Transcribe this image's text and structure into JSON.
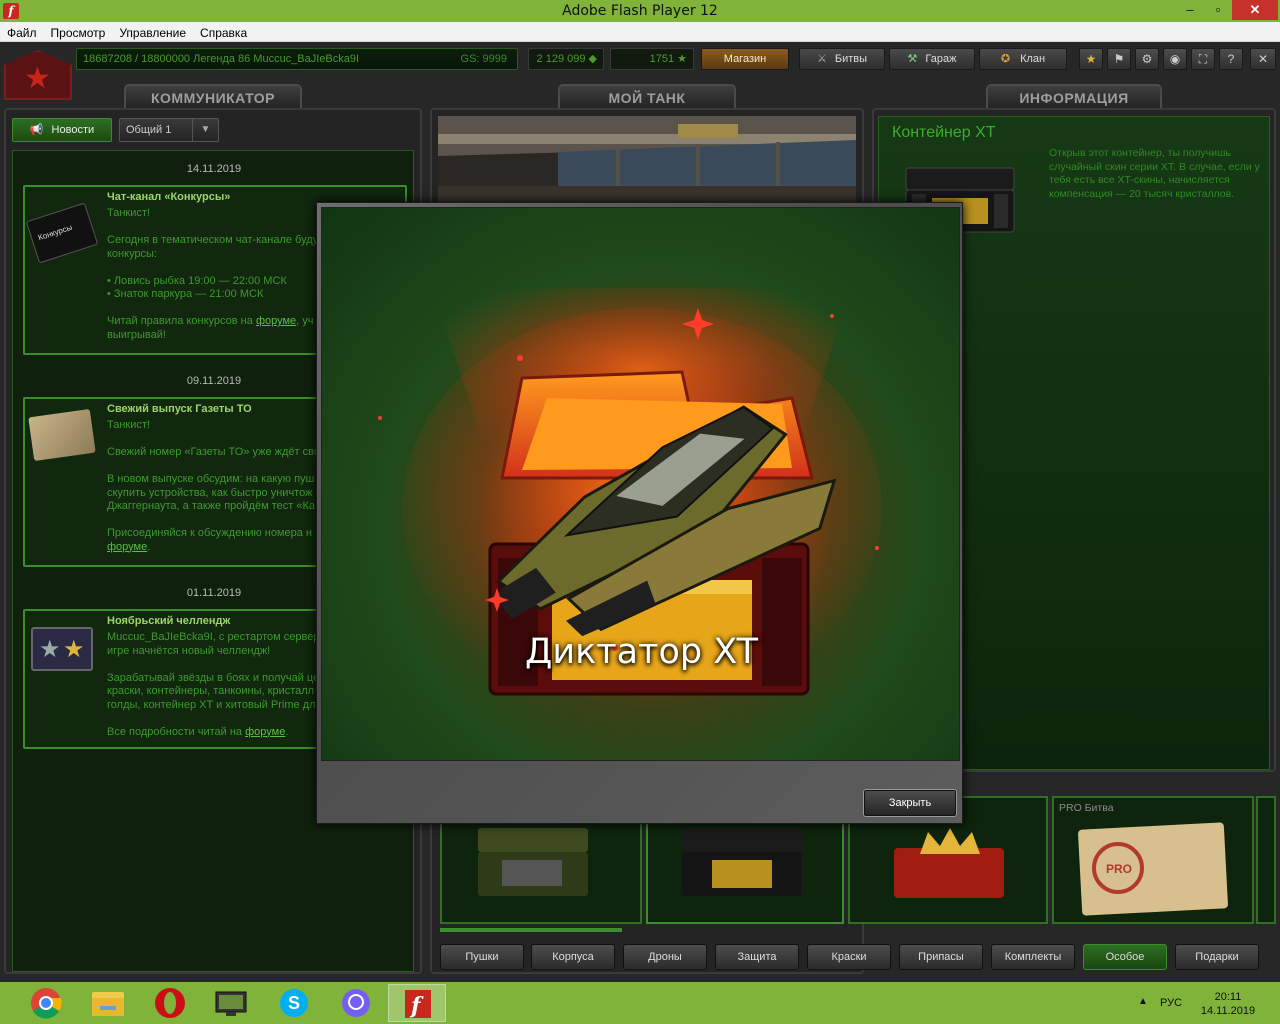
{
  "window": {
    "title": "Adobe Flash Player 12",
    "controls": [
      "–",
      "▫",
      "✕"
    ]
  },
  "menu": [
    "Файл",
    "Просмотр",
    "Управление",
    "Справка"
  ],
  "hud": {
    "rank_text": "18687208 / 18800000  Легенда 86 Muccuc_BaJIeBcka9I",
    "gs": "GS: 9999",
    "crystals": "2 129 099 ◆",
    "stars": "1751 ★",
    "shop": "Магазин",
    "battles": "Битвы",
    "garage": "Гараж",
    "clan": "Клан"
  },
  "sections": {
    "comm": "КОММУНИКАТОР",
    "tank": "МОЙ ТАНК",
    "info": "ИНФОРМАЦИЯ"
  },
  "comm": {
    "news_button": "Новости",
    "chat_select": "Общий 1",
    "news": [
      {
        "date": "14.11.2019",
        "title": "Чат-канал «Конкурсы»",
        "thumb_label": "Конкурсы",
        "body": "Танкист!\n\nСегодня в тематическом чат-канале буду\nконкурсы:\n\n• Ловись рыбка 19:00 — 22:00 МСК\n• Знаток паркура — 21:00 МСК\n\nЧитай правила конкурсов на ",
        "link": "форуме",
        "body_tail": ", уч\nвыигрывай!"
      },
      {
        "date": "09.11.2019",
        "title": "Свежий выпуск Газеты ТО",
        "body": "Танкист!\n\nСвежий номер «Газеты ТО» уже ждёт сво\n\nВ новом выпуске обсудим: на какую пуш\nскупить устройства, как быстро уничтож\nДжаггернаута, а также пройдём тест «Ка\n\nПрисоединяйся к обсуждению номера н\n",
        "link": "форуме",
        "body_tail": "."
      },
      {
        "date": "01.11.2019",
        "title": "Ноябрьский челлендж",
        "body": "Muccuc_BaJIeBcka9I, с рестартом сервер\nигре начнётся новый челлендж!\n\nЗарабатывай звёзды в боях и получай це\nкраски, контейнеры, танкоины, кристалл\nголды, контейнер XT и хитовый Prime дл\n\nВсе подробности читай на ",
        "link": "форуме",
        "body_tail": "."
      }
    ]
  },
  "info": {
    "title": "Контейнер XT",
    "description": "Открыв этот контейнер, ты получишь случайный скин серии XT. В случае, если у тебя есть все XT-скины, начисляется компенсация — 20 тысяч кристаллов."
  },
  "items": [
    {
      "label": ""
    },
    {
      "label": ""
    },
    {
      "label": ""
    },
    {
      "label": "PRO Битва"
    }
  ],
  "categories": [
    "Пушки",
    "Корпуса",
    "Дроны",
    "Защита",
    "Краски",
    "Припасы",
    "Комплекты",
    "Особое",
    "Подарки"
  ],
  "active_category": "Особое",
  "modal": {
    "title": "Диктатор XT",
    "close": "Закрыть"
  },
  "taskbar": {
    "apps": [
      "chrome-icon",
      "explorer-icon",
      "opera-icon",
      "monitor-icon",
      "skype-icon",
      "viber-icon",
      "flash-icon"
    ],
    "lang": "РУС",
    "time": "20:11",
    "date": "14.11.2019"
  },
  "colors": {
    "accent_green": "#3b8f2a",
    "titlebar": "#7fb33a",
    "close_red": "#c7312b"
  }
}
